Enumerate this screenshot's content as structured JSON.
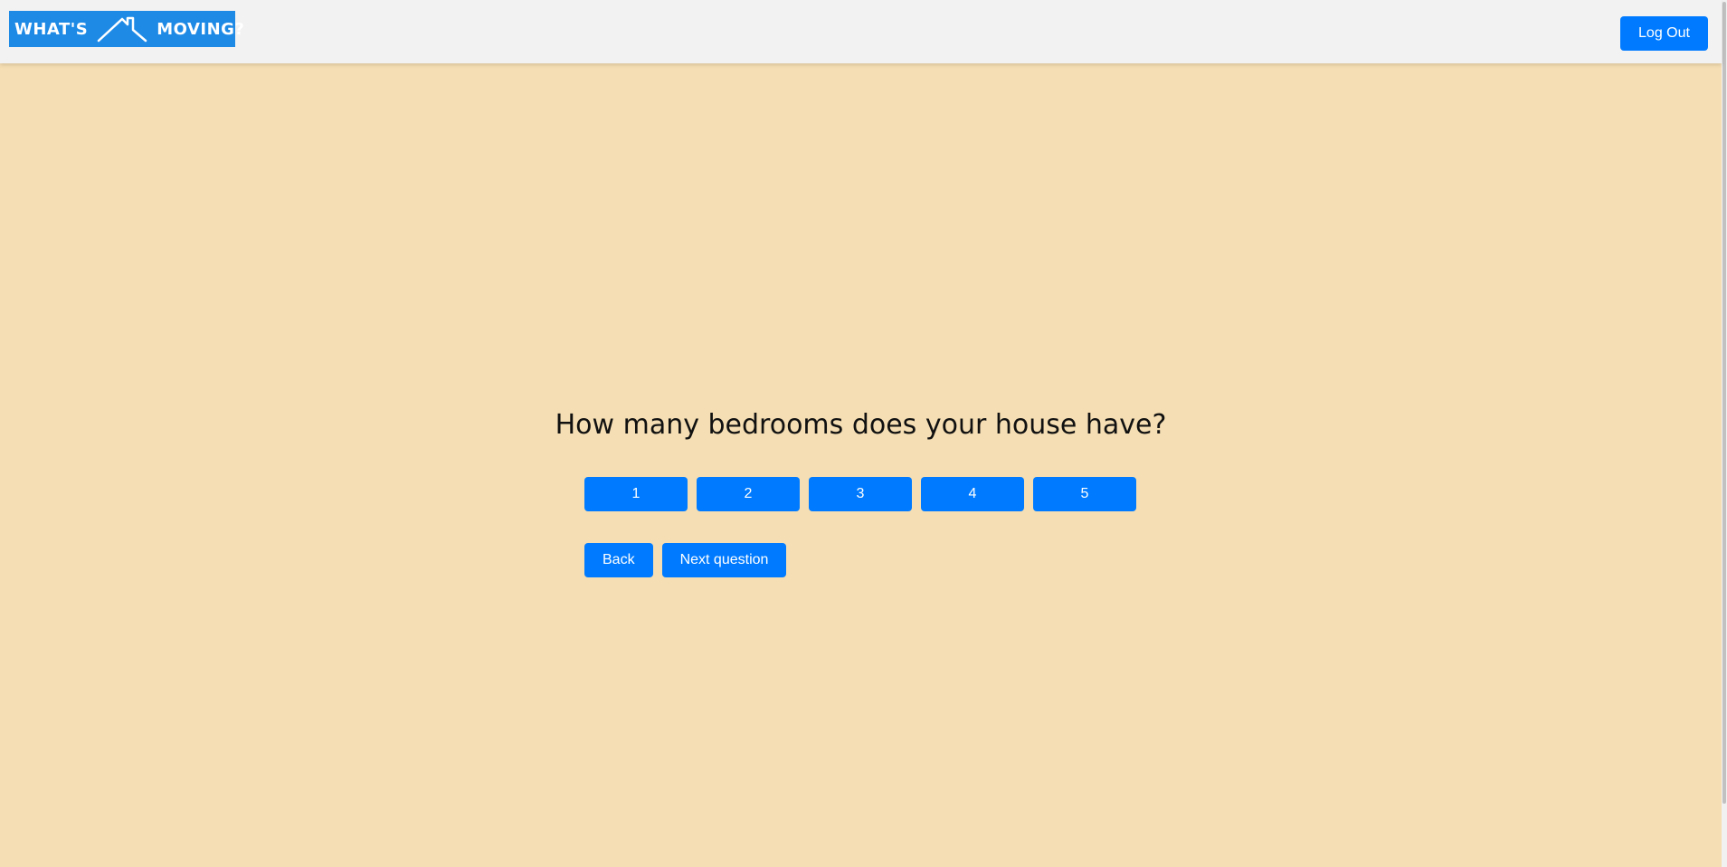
{
  "header": {
    "logo_left": "WHAT'S",
    "logo_right": "MOVING?",
    "logout_label": "Log Out"
  },
  "colors": {
    "background": "#f5deb3",
    "navbar": "#f2f2f2",
    "button": "#007bff",
    "logo": "#1e8ae6"
  },
  "icons": {
    "logo": "house-roof-icon"
  },
  "main": {
    "question": "How many bedrooms does your house have?",
    "answers": [
      "1",
      "2",
      "3",
      "4",
      "5"
    ],
    "back_label": "Back",
    "next_label": "Next question"
  }
}
